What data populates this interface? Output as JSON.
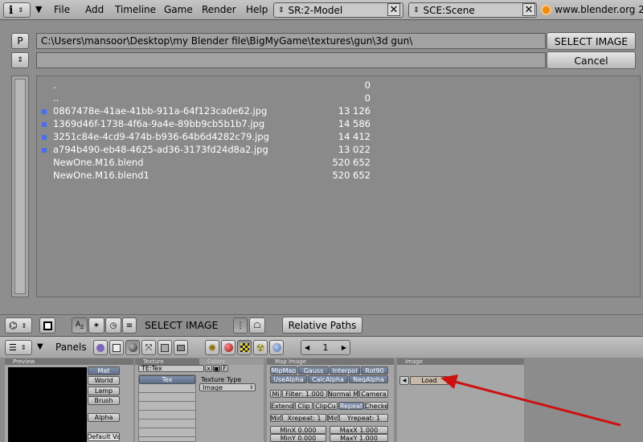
{
  "topbar": {
    "info_icon": "info-icon",
    "menus": [
      "File",
      "Add",
      "Timeline",
      "Game",
      "Render",
      "Help"
    ],
    "screen_field": "SR:2-Model",
    "scene_field": "SCE:Scene",
    "url": "www.blender.org 2"
  },
  "filebrowser": {
    "parent_button": "P",
    "path": "C:\\Users\\mansoor\\Desktop\\my Blender file\\BigMyGame\\textures\\gun\\3d gun\\",
    "filename": "",
    "select_button": "SELECT IMAGE",
    "cancel_button": "Cancel",
    "files": [
      {
        "name": ".",
        "size": "0",
        "image": false
      },
      {
        "name": "..",
        "size": "0",
        "image": false
      },
      {
        "name": "0867478e-41ae-41bb-911a-64f123ca0e62.jpg",
        "size": "13 126",
        "image": true
      },
      {
        "name": "1369d46f-1738-4f6a-9a4e-89bb9cb5b1b7.jpg",
        "size": "14 586",
        "image": true
      },
      {
        "name": "3251c84e-4cd9-474b-b936-64b6d4282c79.jpg",
        "size": "14 412",
        "image": true
      },
      {
        "name": "a794b490-eb48-4625-ad36-3173fd24d8a2.jpg",
        "size": "13 022",
        "image": true
      },
      {
        "name": "NewOne.M16.blend",
        "size": "520 652",
        "image": false
      },
      {
        "name": "NewOne.M16.blend1",
        "size": "520 652",
        "image": false
      }
    ],
    "footer_title": "SELECT IMAGE",
    "relative_paths": "Relative Paths"
  },
  "panelsbar": {
    "label": "Panels",
    "frame": "1"
  },
  "preview_panel": {
    "title": "Preview",
    "buttons": [
      "Mat",
      "World",
      "Lamp",
      "Brush"
    ],
    "alpha": "Alpha",
    "default_vars": "Default Va"
  },
  "texture_panel": {
    "title": "Texture",
    "tex_name": "TE:Tex",
    "tex_f": "F",
    "tex_slot": "Tex",
    "colors_tab": "Colors",
    "texture_type_label": "Texture Type",
    "texture_type_value": "Image"
  },
  "map_image_panel": {
    "title": "Map Image",
    "row1": [
      "MipMap",
      "Gauss",
      "Interpol",
      "Rot90"
    ],
    "row2": [
      "UseAlpha",
      "CalcAlpha",
      "NegAlpha"
    ],
    "row3": [
      "Mi",
      "Filter: 1.000",
      "Normal M",
      "Camera"
    ],
    "row4": [
      "Extend",
      "Clip",
      "ClipCu",
      "Repeat",
      "Checke"
    ],
    "row5": [
      "Mir",
      "Xrepeat: 1",
      "Mir",
      "Yrepeat: 1"
    ],
    "row6": [
      "MinX 0.000",
      "MaxX 1.000"
    ],
    "row7": [
      "MinY 0.000",
      "MaxY 1.000"
    ]
  },
  "image_panel": {
    "title": "Image",
    "load_button": "Load"
  },
  "annotation": {
    "arrow_color": "#cc1111"
  }
}
